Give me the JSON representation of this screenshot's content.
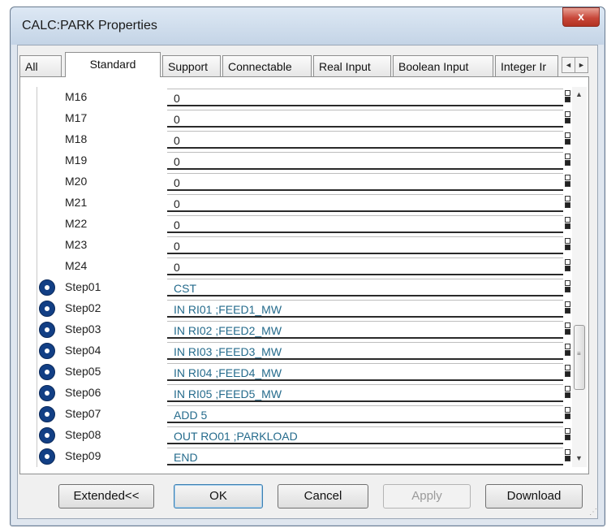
{
  "window": {
    "title": "CALC:PARK Properties",
    "close_glyph": "x"
  },
  "tabs": [
    {
      "label": "All",
      "active": false
    },
    {
      "label": "Standard",
      "active": true
    },
    {
      "label": "Support",
      "active": false
    },
    {
      "label": "Connectable",
      "active": false
    },
    {
      "label": "Real Input",
      "active": false
    },
    {
      "label": "Boolean Input",
      "active": false
    },
    {
      "label": "Integer Ir",
      "active": false
    }
  ],
  "tab_scroll": {
    "left": "◄",
    "right": "►"
  },
  "rows": [
    {
      "label": "M16",
      "value": "0"
    },
    {
      "label": "M17",
      "value": "0"
    },
    {
      "label": "M18",
      "value": "0"
    },
    {
      "label": "M19",
      "value": "0"
    },
    {
      "label": "M20",
      "value": "0"
    },
    {
      "label": "M21",
      "value": "0"
    },
    {
      "label": "M22",
      "value": "0"
    },
    {
      "label": "M23",
      "value": "0"
    },
    {
      "label": "M24",
      "value": "0"
    },
    {
      "label": "Step01",
      "value": "CST",
      "icon": "step-circle-icon"
    },
    {
      "label": "Step02",
      "value": "IN RI01 ;FEED1_MW",
      "icon": "step-circle-icon"
    },
    {
      "label": "Step03",
      "value": "IN RI02 ;FEED2_MW",
      "icon": "step-circle-icon"
    },
    {
      "label": "Step04",
      "value": "IN RI03 ;FEED3_MW",
      "icon": "step-circle-icon"
    },
    {
      "label": "Step05",
      "value": "IN RI04 ;FEED4_MW",
      "icon": "step-circle-icon"
    },
    {
      "label": "Step06",
      "value": "IN RI05 ;FEED5_MW",
      "icon": "step-circle-icon"
    },
    {
      "label": "Step07",
      "value": "ADD 5",
      "icon": "step-circle-icon"
    },
    {
      "label": "Step08",
      "value": "OUT RO01 ;PARKLOAD",
      "icon": "step-circle-icon"
    },
    {
      "label": "Step09",
      "value": "END",
      "icon": "step-circle-icon"
    }
  ],
  "scrollbar": {
    "up": "▲",
    "down": "▼",
    "grip": "≡"
  },
  "buttons": {
    "extended": "Extended<<",
    "ok": "OK",
    "cancel": "Cancel",
    "apply": "Apply",
    "download": "Download"
  },
  "colors": {
    "step_icon": "#123f85",
    "step_text": "#256b8c",
    "close_button": "#c8483a"
  }
}
